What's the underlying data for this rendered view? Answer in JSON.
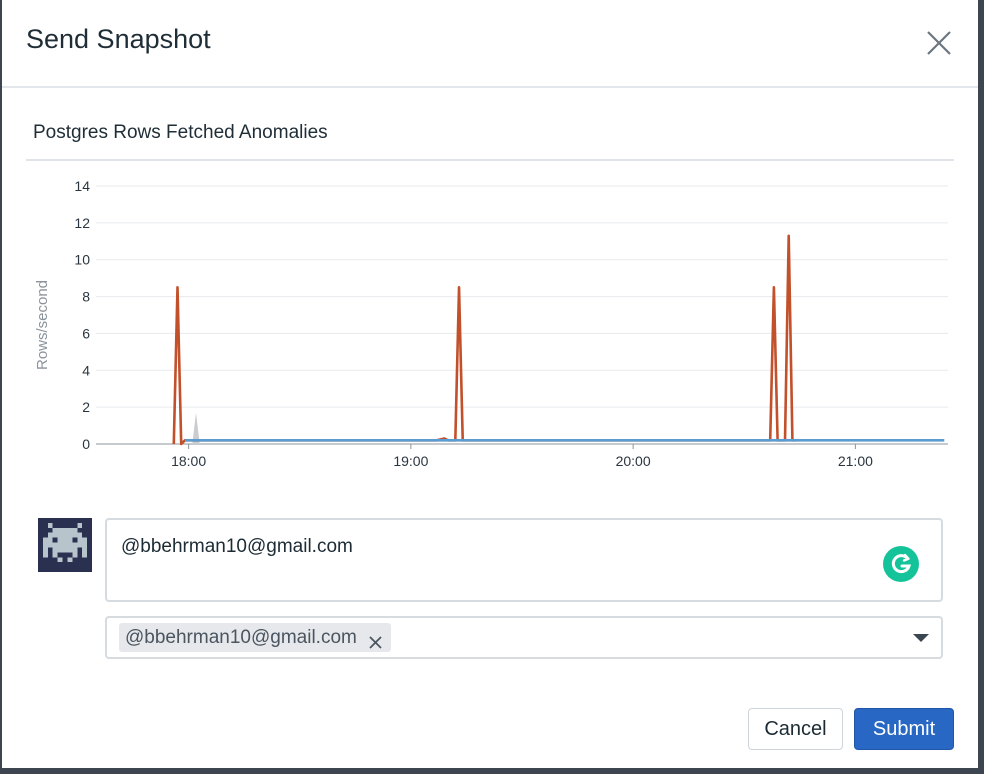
{
  "dialog": {
    "title": "Send Snapshot",
    "close_icon": "close-icon"
  },
  "chart_data": {
    "type": "line",
    "title": "Postgres Rows Fetched Anomalies",
    "xlabel": "",
    "ylabel": "Rows/second",
    "ylim": [
      0,
      14
    ],
    "yticks": [
      0,
      2,
      4,
      6,
      8,
      10,
      12,
      14
    ],
    "xticks": [
      "18:00",
      "19:00",
      "20:00",
      "21:00"
    ],
    "xlim": [
      "17:35",
      "21:25"
    ],
    "grid": true,
    "series": [
      {
        "color": "#c2502b",
        "points": [
          [
            "17:56",
            0
          ],
          [
            "17:57",
            8.5
          ],
          [
            "17:58",
            0
          ],
          [
            "17:59",
            0.2
          ],
          [
            "18:02",
            0.2
          ],
          [
            "19:07",
            0.2
          ],
          [
            "19:09",
            0.3
          ],
          [
            "19:10",
            0.2
          ],
          [
            "19:12",
            0.2
          ],
          [
            "19:13",
            8.5
          ],
          [
            "19:14",
            0.2
          ],
          [
            "20:37",
            0.2
          ],
          [
            "20:38",
            8.5
          ],
          [
            "20:39",
            0.2
          ],
          [
            "20:41",
            0.2
          ],
          [
            "20:42",
            11.3
          ],
          [
            "20:43",
            0.2
          ],
          [
            "20:44",
            0.2
          ]
        ]
      },
      {
        "color": "#5a9bd0",
        "points": [
          [
            "17:59",
            0.2
          ],
          [
            "19:07",
            0.2
          ],
          [
            "19:09",
            0.2
          ],
          [
            "19:12",
            0.2
          ],
          [
            "20:37",
            0.2
          ],
          [
            "20:44",
            0.2
          ],
          [
            "21:24",
            0.2
          ]
        ]
      }
    ],
    "band": {
      "color": "#c9ccd0",
      "points": [
        [
          "18:01",
          0
        ],
        [
          "18:02",
          1.7
        ],
        [
          "18:03",
          0
        ]
      ]
    }
  },
  "author": {
    "avatar_icon": "pixel-invader-avatar"
  },
  "comment": {
    "text": "@bbehrman10@gmail.com",
    "grammarly_icon": "grammarly-icon"
  },
  "recipients": {
    "tags": [
      "@bbehrman10@gmail.com"
    ],
    "remove_icon": "close-icon",
    "dropdown_icon": "chevron-down-icon"
  },
  "actions": {
    "cancel_label": "Cancel",
    "submit_label": "Submit"
  },
  "colors": {
    "primary": "#2867c3",
    "series_anomaly": "#c2502b",
    "series_baseline": "#5a9bd0",
    "grammarly": "#15c39a"
  }
}
